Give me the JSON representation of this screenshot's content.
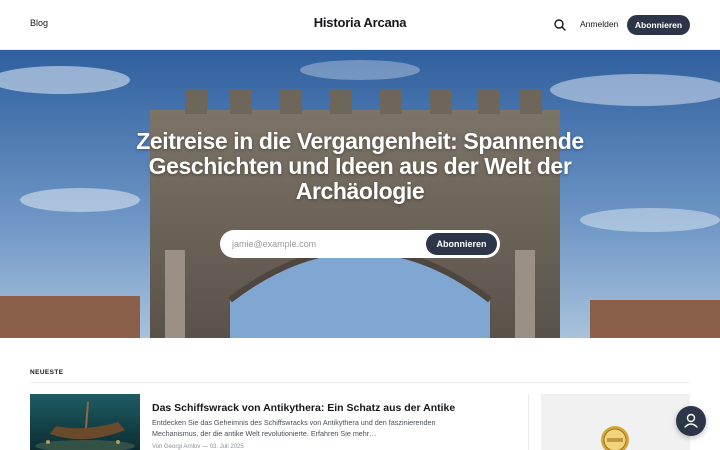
{
  "header": {
    "nav_blog": "Blog",
    "site_title": "Historia Arcana",
    "signin_label": "Anmelden",
    "subscribe_label": "Abonnieren"
  },
  "hero": {
    "title": "Zeitreise in die Vergangenheit: Spannende Geschichten und Ideen aus der Welt der Archäologie",
    "email_placeholder": "jamie@example.com",
    "subscribe_label": "Abonnieren"
  },
  "latest": {
    "section_label": "NEUESTE",
    "posts": [
      {
        "title": "Das Schiffswrack von Antikythera: Ein Schatz aus der Antike",
        "excerpt": "Entdecken Sie das Geheimnis des Schiffswracks von Antikythera und den faszinierenden Mechanismus, der die antike Welt revolutionierte. Erfahren Sie mehr…",
        "meta": "Von Georgi Arnlov — 03. Juli 2025"
      }
    ]
  },
  "colors": {
    "accent": "#2d3648",
    "sky": "#3f6fae",
    "stone": "#8a7f74"
  },
  "icons": {
    "search": "search-icon",
    "portal": "user-icon"
  }
}
